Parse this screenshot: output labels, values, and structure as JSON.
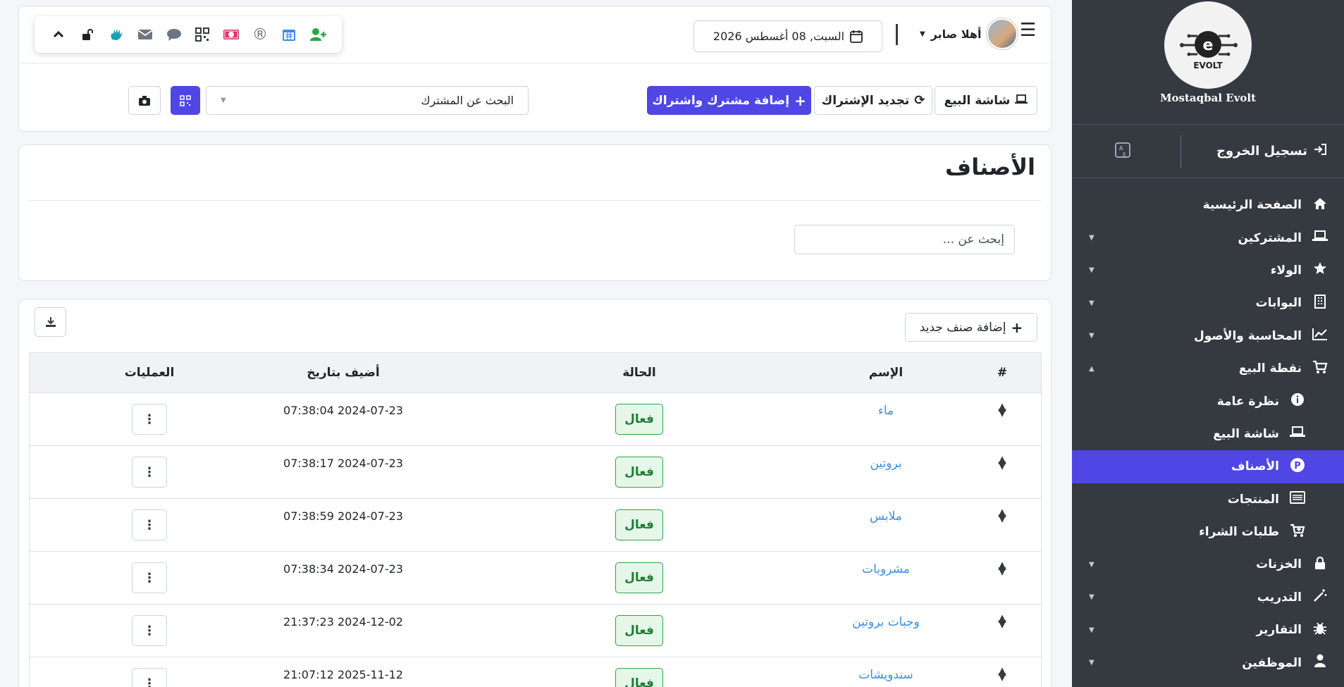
{
  "sidebar": {
    "brand_name": "Mostaqbal Evolt",
    "logo_text": "EVOLT",
    "logout_label": "تسجيل الخروج",
    "items": [
      {
        "label": "الصفحة الرئيسية",
        "icon": "home-icon",
        "caret": false
      },
      {
        "label": "المشتركين",
        "icon": "laptop-icon",
        "caret": true
      },
      {
        "label": "الولاء",
        "icon": "star-icon",
        "caret": true
      },
      {
        "label": "البوابات",
        "icon": "building-icon",
        "caret": true
      },
      {
        "label": "المحاسبة والأصول",
        "icon": "chart-line-icon",
        "caret": true
      },
      {
        "label": "نقطة البيع",
        "icon": "cart-icon",
        "caret": true
      },
      {
        "label": "نظرة عامة",
        "icon": "info-icon",
        "caret": false
      },
      {
        "label": "شاشة البيع",
        "icon": "laptop-icon",
        "caret": false
      },
      {
        "label": "الأصناف",
        "icon": "p-circle-icon",
        "caret": false
      },
      {
        "label": "المنتجات",
        "icon": "list-icon",
        "caret": false
      },
      {
        "label": "طلبات الشراء",
        "icon": "cart-plus-icon",
        "caret": false
      },
      {
        "label": "الخزنات",
        "icon": "lock-icon",
        "caret": true
      },
      {
        "label": "التدريب",
        "icon": "magic-wand-icon",
        "caret": true
      },
      {
        "label": "التقارير",
        "icon": "bug-icon",
        "caret": true
      },
      {
        "label": "الموظفين",
        "icon": "user-icon",
        "caret": true
      }
    ]
  },
  "header": {
    "date": "السبت, 08 أغسطس 2026",
    "user_greeting": "أهلا صابر"
  },
  "toolbar": {
    "sales_screen": "شاشة البيع",
    "renew_subscription": "تجديد الإشتراك",
    "add_subscriber": "إضافة مشترك واشتراك",
    "subscriber_search_placeholder": "البحث عن المشترك"
  },
  "categories": {
    "title": "الأصناف",
    "search_placeholder": "إبحث عن ...",
    "add_button": "إضافة صنف جديد",
    "columns": [
      "#",
      "الإسم",
      "الحالة",
      "أضيف بتاريخ",
      "العمليات"
    ],
    "rows": [
      {
        "name": "ماء",
        "status": "فعال",
        "date": "07:38:04 2024-07-23"
      },
      {
        "name": "بروتين",
        "status": "فعال",
        "date": "07:38:17 2024-07-23"
      },
      {
        "name": "ملابس",
        "status": "فعال",
        "date": "07:38:59 2024-07-23"
      },
      {
        "name": "مشروبات",
        "status": "فعال",
        "date": "07:38:34 2024-07-23"
      },
      {
        "name": "وجبات بروتين",
        "status": "فعال",
        "date": "21:37:23 2024-12-02"
      },
      {
        "name": "سندويشات",
        "status": "فعال",
        "date": "21:07:12 2025-11-12"
      }
    ]
  },
  "colors": {
    "primary": "#4f46e5",
    "sidebar_bg": "#343a40",
    "link": "#3a8ee6",
    "success": "#28a745"
  }
}
